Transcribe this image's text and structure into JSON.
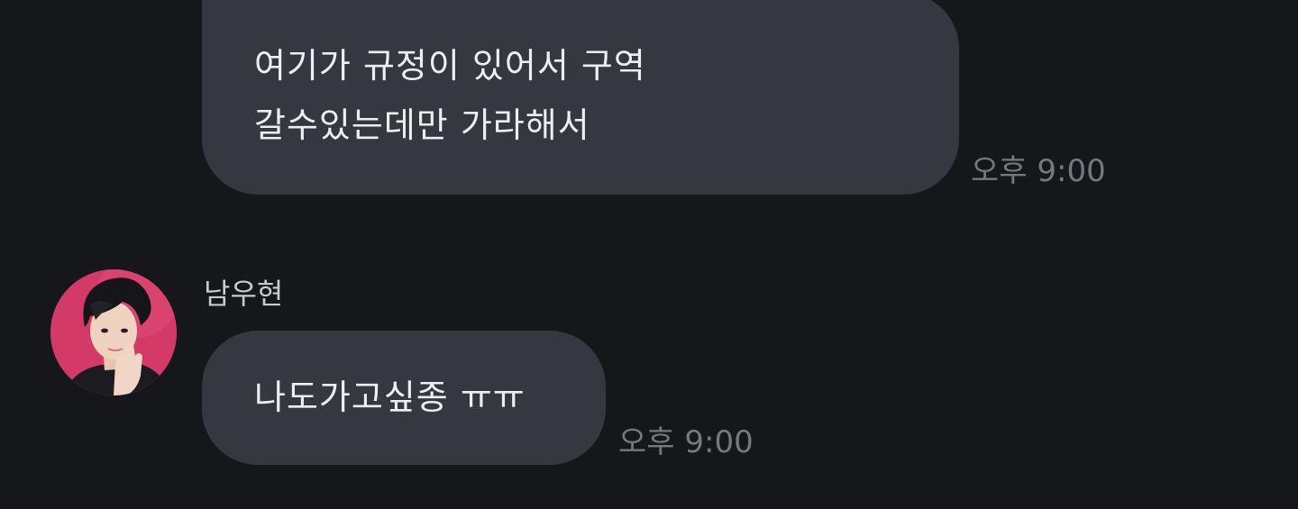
{
  "messages": [
    {
      "lines": [
        "여기가 규정이 있어서 구역",
        "갈수있는데만 가라해서"
      ],
      "time": "오후 9:00"
    },
    {
      "sender": "남우현",
      "avatar_icon": "profile-photo-avatar",
      "lines": [
        "나도가고싶종 ㅠㅠ"
      ],
      "time": "오후 9:00"
    }
  ],
  "colors": {
    "background": "#16171b",
    "bubble": "#363840",
    "bubble_text": "#eeeef0",
    "timestamp": "#76787e",
    "sender_name": "#c9cacd",
    "avatar_bg": "#d43a68"
  }
}
